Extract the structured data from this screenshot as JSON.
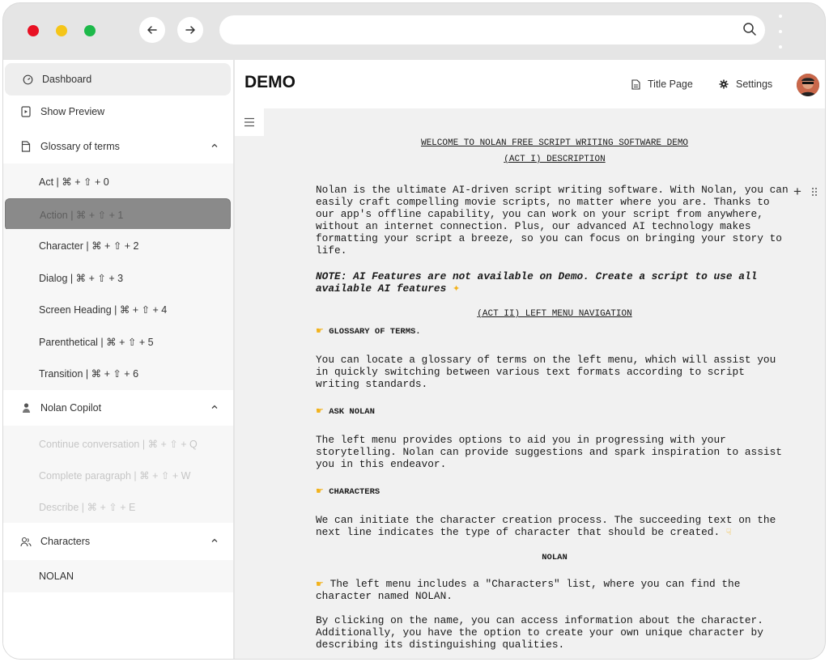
{
  "browser": {
    "url": "",
    "icons": [
      "close-dot",
      "minimize-dot",
      "zoom-dot",
      "back-arrow-icon",
      "forward-arrow-icon",
      "search-icon",
      "kebab-menu-icon"
    ]
  },
  "sidebar": {
    "dashboard": "Dashboard",
    "show_preview": "Show Preview",
    "glossary": {
      "label": "Glossary of terms",
      "items": [
        "Act | ⌘ + ⇧ + 0",
        "Action | ⌘ + ⇧ + 1",
        "Character | ⌘ + ⇧ + 2",
        "Dialog | ⌘ + ⇧ + 3",
        "Screen Heading | ⌘ + ⇧ + 4",
        "Parenthetical | ⌘ + ⇧ + 5",
        "Transition | ⌘ + ⇧ + 6"
      ],
      "selected_index": 1
    },
    "copilot": {
      "label": "Nolan Copilot",
      "items": [
        "Continue conversation | ⌘ + ⇧ + Q",
        "Complete paragraph | ⌘ + ⇧ + W",
        "Describe | ⌘ + ⇧ + E"
      ]
    },
    "characters": {
      "label": "Characters",
      "items": [
        "NOLAN"
      ]
    }
  },
  "header": {
    "title": "DEMO",
    "title_page": "Title Page",
    "settings": "Settings"
  },
  "document": {
    "heading1": "WELCOME TO NOLAN FREE SCRIPT WRITING SOFTWARE DEMO",
    "heading2": "(ACT I) DESCRIPTION",
    "intro": "Nolan is the ultimate AI-driven script writing software. With Nolan, you can easily craft compelling movie scripts, no matter where you are. Thanks to our app's offline capability, you can work on your script from anywhere, without an internet connection. Plus, our advanced AI technology makes formatting your script a breeze, so you can focus on bringing your story to life.",
    "note": "NOTE: AI Features are not available on Demo. Create a script to use all available AI features",
    "heading3": "(ACT II) LEFT MENU NAVIGATION",
    "glossary_title": "GLOSSARY OF TERMS.",
    "glossary_text": "You can locate a glossary of terms on the left menu, which will assist you in quickly switching between various text formats according to script writing standards.",
    "ask_title": "ASK NOLAN",
    "ask_text": "The left menu provides options to aid you in progressing with your storytelling. Nolan can provide suggestions and spark inspiration to assist you in this endeavor.",
    "characters_title": "CHARACTERS",
    "characters_text": "We can initiate the character creation process. The succeeding text on the next line indicates the type of character that should be created.",
    "character_name": "NOLAN",
    "list_text": "The left menu includes a \"Characters\" list, where you can find the character named NOLAN.",
    "click_text": "By clicking on the name, you can access information about the character. Additionally, you have the option to create your own unique character by describing its distinguishing qualities."
  },
  "colors": {
    "accent_selected": "#8a8a8a",
    "window_chrome": "#e5e5e5",
    "close": "#e81123",
    "minimize": "#f5c518",
    "zoom": "#1db94a"
  }
}
